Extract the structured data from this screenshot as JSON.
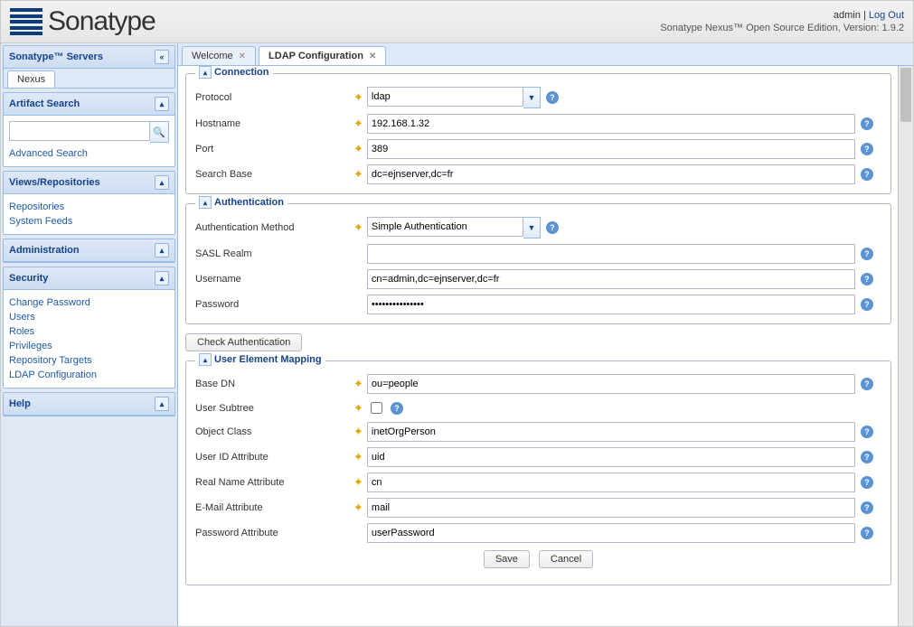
{
  "header": {
    "brand": "Sonatype",
    "user": "admin",
    "logout": "Log Out",
    "version_line": "Sonatype Nexus™ Open Source Edition, Version: 1.9.2"
  },
  "sidebar": {
    "servers": {
      "title": "Sonatype™ Servers",
      "tab": "Nexus"
    },
    "search": {
      "title": "Artifact Search",
      "placeholder": "",
      "advanced": "Advanced Search"
    },
    "views": {
      "title": "Views/Repositories",
      "items": [
        "Repositories",
        "System Feeds"
      ]
    },
    "admin": {
      "title": "Administration"
    },
    "security": {
      "title": "Security",
      "items": [
        "Change Password",
        "Users",
        "Roles",
        "Privileges",
        "Repository Targets",
        "LDAP Configuration"
      ]
    },
    "help": {
      "title": "Help"
    }
  },
  "tabs": [
    {
      "label": "Welcome",
      "active": false
    },
    {
      "label": "LDAP Configuration",
      "active": true
    }
  ],
  "form": {
    "sections": {
      "connection": {
        "legend": "Connection",
        "fields": {
          "protocol": {
            "label": "Protocol",
            "value": "ldap"
          },
          "hostname": {
            "label": "Hostname",
            "value": "192.168.1.32"
          },
          "port": {
            "label": "Port",
            "value": "389"
          },
          "search_base": {
            "label": "Search Base",
            "value": "dc=ejnserver,dc=fr"
          }
        }
      },
      "authentication": {
        "legend": "Authentication",
        "fields": {
          "method": {
            "label": "Authentication Method",
            "value": "Simple Authentication"
          },
          "sasl": {
            "label": "SASL Realm",
            "value": ""
          },
          "username": {
            "label": "Username",
            "value": "cn=admin,dc=ejnserver,dc=fr"
          },
          "password": {
            "label": "Password",
            "value": "•••••••••••••••"
          }
        }
      },
      "check_btn": "Check Authentication",
      "user_mapping": {
        "legend": "User Element Mapping",
        "fields": {
          "base_dn": {
            "label": "Base DN",
            "value": "ou=people"
          },
          "subtree": {
            "label": "User Subtree",
            "checked": false
          },
          "object_class": {
            "label": "Object Class",
            "value": "inetOrgPerson"
          },
          "user_id": {
            "label": "User ID Attribute",
            "value": "uid"
          },
          "real_name": {
            "label": "Real Name Attribute",
            "value": "cn"
          },
          "email": {
            "label": "E-Mail Attribute",
            "value": "mail"
          },
          "password_attr": {
            "label": "Password Attribute",
            "value": "userPassword"
          }
        }
      }
    },
    "buttons": {
      "save": "Save",
      "cancel": "Cancel"
    }
  }
}
